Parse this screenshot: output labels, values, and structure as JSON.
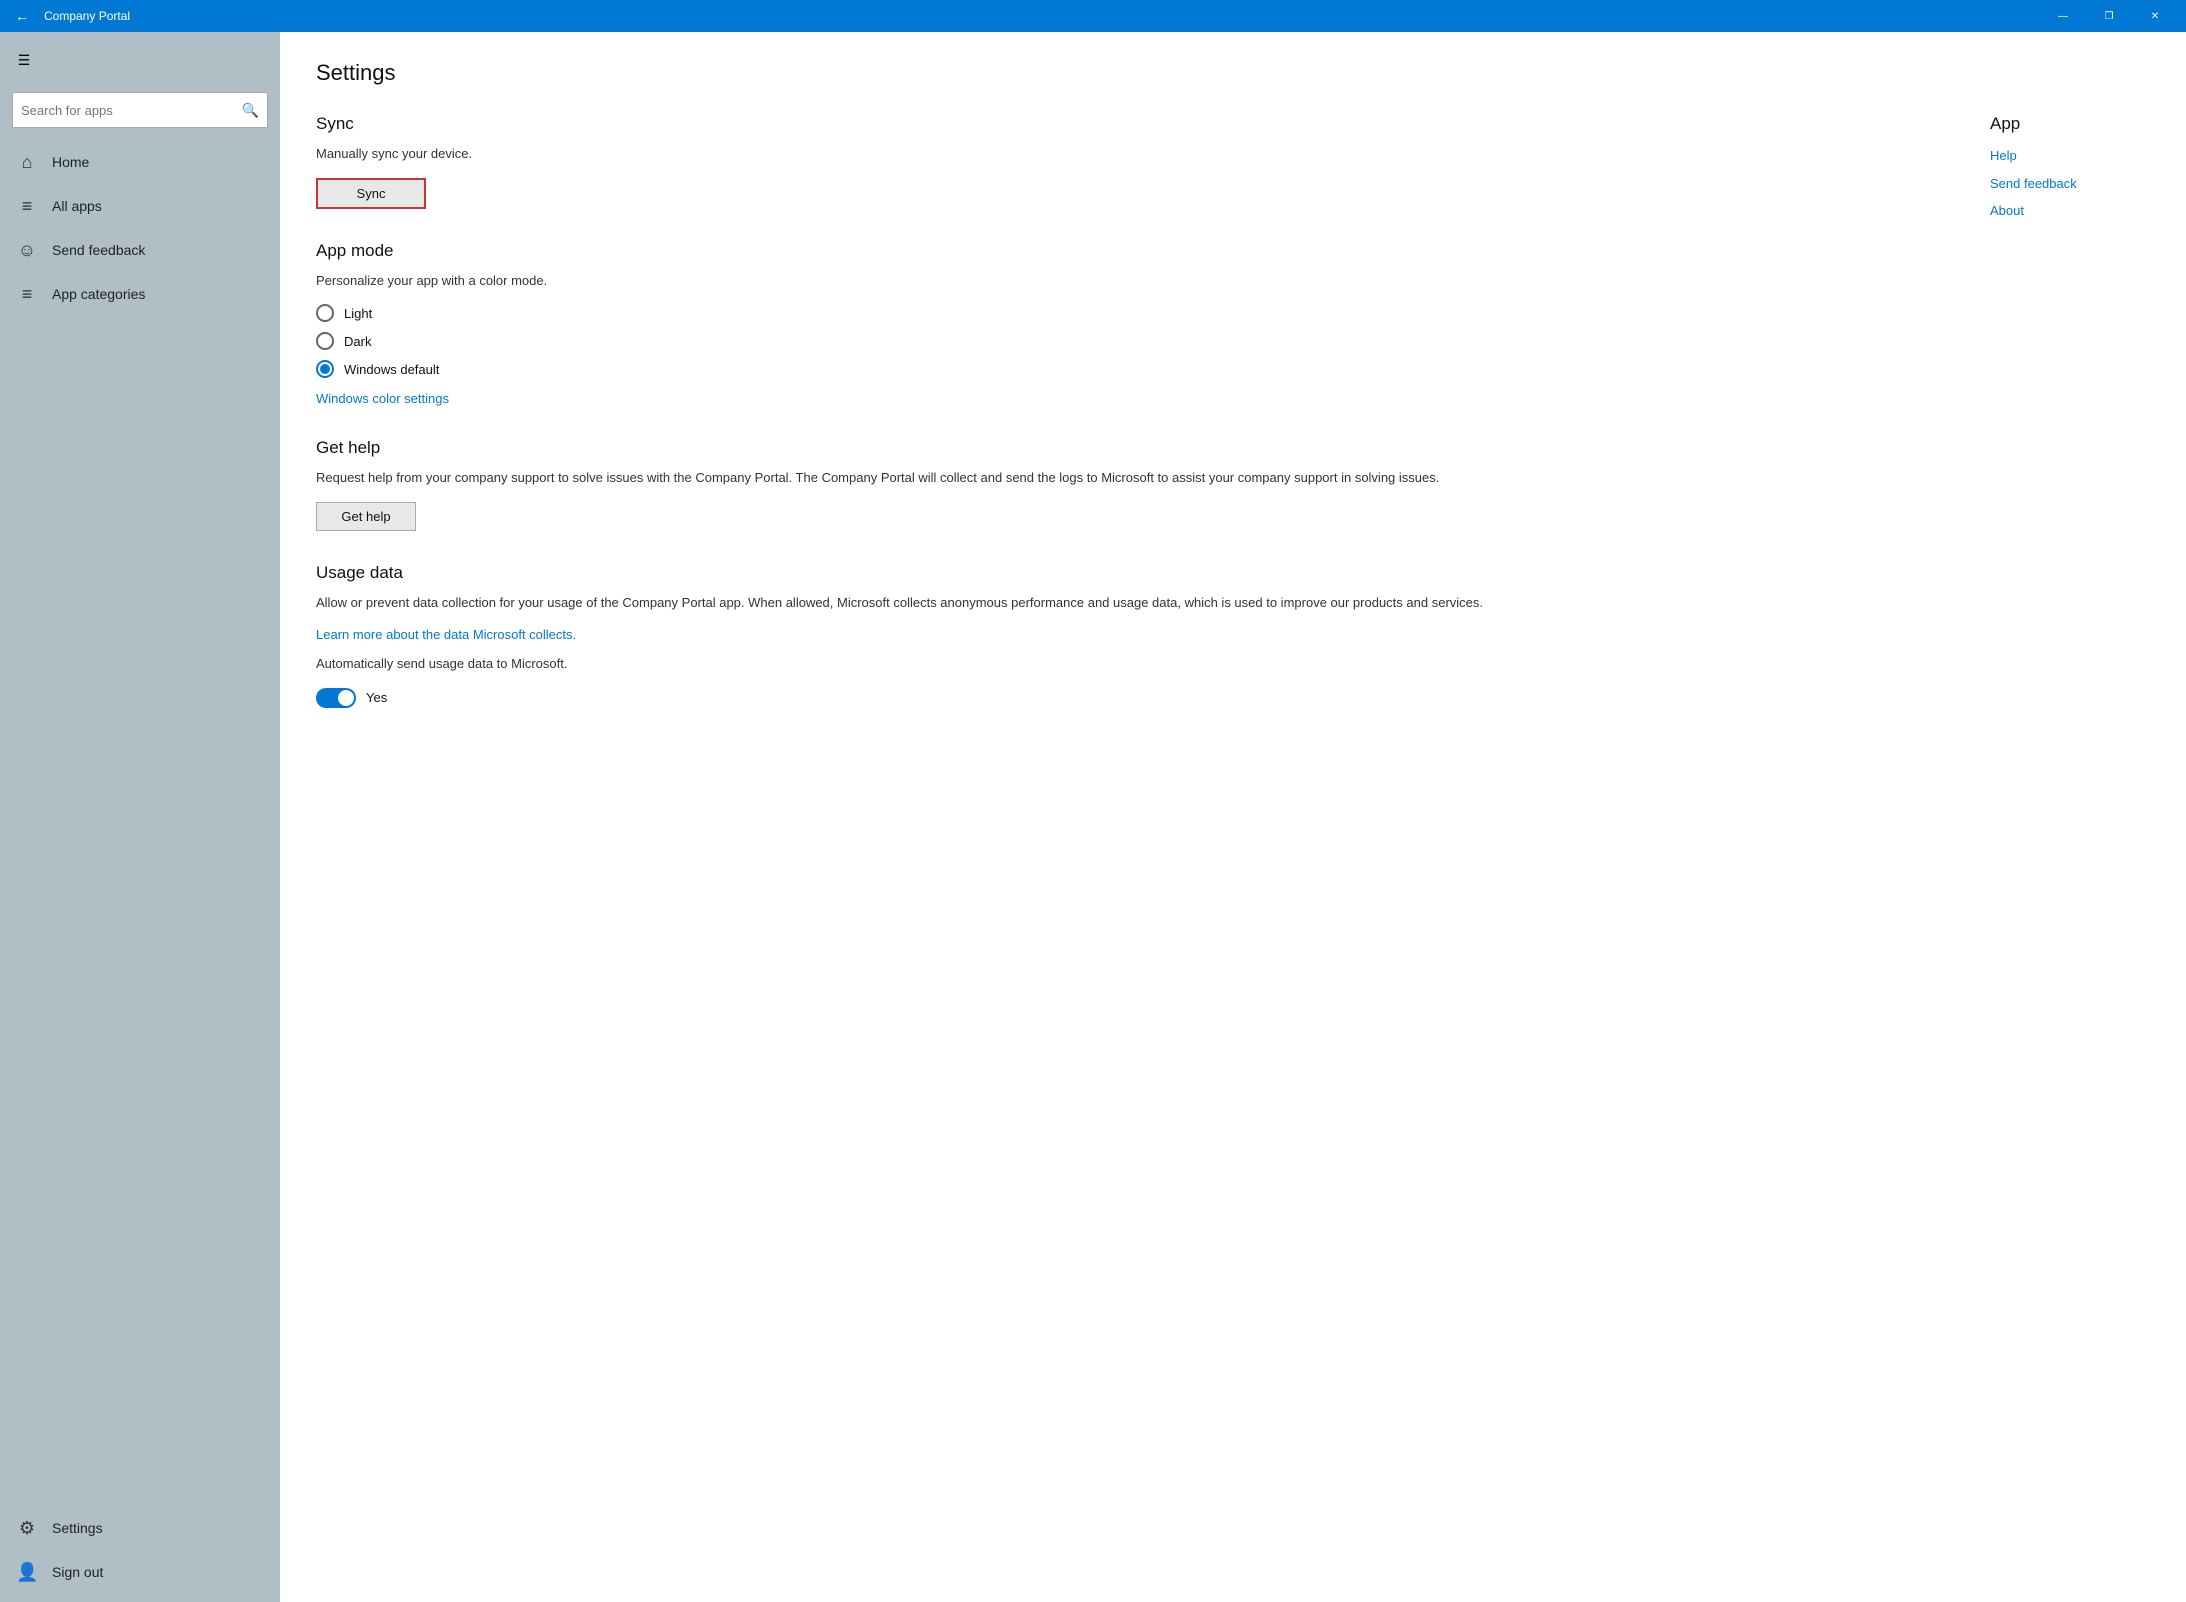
{
  "titlebar": {
    "title": "Company Portal",
    "back_icon": "←",
    "minimize": "—",
    "maximize": "❐",
    "close": "✕"
  },
  "sidebar": {
    "hamburger_icon": "☰",
    "search_placeholder": "Search for apps",
    "search_icon": "🔍",
    "nav_items": [
      {
        "id": "home",
        "icon": "⌂",
        "label": "Home"
      },
      {
        "id": "all-apps",
        "icon": "≡",
        "label": "All apps"
      },
      {
        "id": "send-feedback",
        "icon": "☺",
        "label": "Send feedback"
      },
      {
        "id": "app-categories",
        "icon": "≡",
        "label": "App categories"
      }
    ],
    "bottom_items": [
      {
        "id": "settings",
        "icon": "⚙",
        "label": "Settings"
      },
      {
        "id": "sign-out",
        "icon": "👤",
        "label": "Sign out"
      }
    ]
  },
  "main": {
    "page_title": "Settings",
    "sections": {
      "sync": {
        "title": "Sync",
        "description": "Manually sync your device.",
        "button_label": "Sync"
      },
      "app_mode": {
        "title": "App mode",
        "description": "Personalize your app with a color mode.",
        "options": [
          {
            "id": "light",
            "label": "Light",
            "selected": false
          },
          {
            "id": "dark",
            "label": "Dark",
            "selected": false
          },
          {
            "id": "windows-default",
            "label": "Windows default",
            "selected": true
          }
        ],
        "color_settings_link": "Windows color settings"
      },
      "get_help": {
        "title": "Get help",
        "description": "Request help from your company support to solve issues with the Company Portal. The Company Portal will collect and send the logs to Microsoft to assist your company support in solving issues.",
        "button_label": "Get help"
      },
      "usage_data": {
        "title": "Usage data",
        "description": "Allow or prevent data collection for your usage of the Company Portal app. When allowed, Microsoft collects anonymous performance and usage data, which is used to improve our products and services.",
        "learn_more_link": "Learn more about the data Microsoft collects.",
        "auto_send_label": "Automatically send usage data to Microsoft.",
        "toggle_value": "Yes"
      }
    },
    "app_sidebar": {
      "title": "App",
      "links": [
        {
          "id": "help",
          "label": "Help"
        },
        {
          "id": "send-feedback",
          "label": "Send feedback"
        },
        {
          "id": "about",
          "label": "About"
        }
      ]
    }
  }
}
